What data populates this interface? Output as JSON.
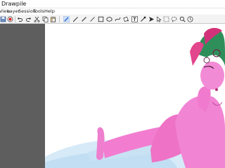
{
  "window": {
    "title": "Drawpile"
  },
  "menu": {
    "items": [
      "View",
      "Layer",
      "Session",
      "Tools",
      "Help"
    ]
  },
  "toolbar": {
    "tools": [
      "save-icon",
      "record-icon",
      "undo-icon",
      "redo-icon",
      "cut-icon",
      "copy-icon",
      "paste-icon",
      "pen-icon",
      "brush-icon",
      "eraser-icon",
      "line-icon",
      "rectangle-icon",
      "ellipse-icon",
      "bezier-icon",
      "fill-icon",
      "text-icon",
      "color-picker-icon",
      "laser-pointer-icon",
      "selection-icon",
      "lasso-icon",
      "zoom-icon",
      "inspector-icon"
    ]
  },
  "colors": {
    "panel": "#5e5e5e",
    "canvas": "#ffffff",
    "skin": "#f07fd0",
    "hair_green": "#2f8f5a",
    "hair_pink": "#d2327a",
    "sheet": "#cfe6f6",
    "accent": "#2a6bd6"
  }
}
